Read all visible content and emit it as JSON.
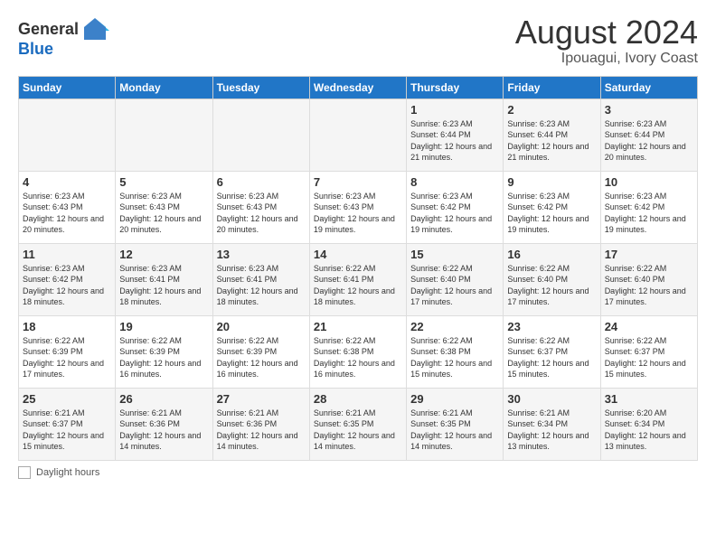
{
  "header": {
    "logo_line1": "General",
    "logo_line2": "Blue",
    "month_title": "August 2024",
    "location": "Ipouagui, Ivory Coast"
  },
  "days_of_week": [
    "Sunday",
    "Monday",
    "Tuesday",
    "Wednesday",
    "Thursday",
    "Friday",
    "Saturday"
  ],
  "weeks": [
    [
      {
        "day": "",
        "info": ""
      },
      {
        "day": "",
        "info": ""
      },
      {
        "day": "",
        "info": ""
      },
      {
        "day": "",
        "info": ""
      },
      {
        "day": "1",
        "info": "Sunrise: 6:23 AM\nSunset: 6:44 PM\nDaylight: 12 hours and 21 minutes."
      },
      {
        "day": "2",
        "info": "Sunrise: 6:23 AM\nSunset: 6:44 PM\nDaylight: 12 hours and 21 minutes."
      },
      {
        "day": "3",
        "info": "Sunrise: 6:23 AM\nSunset: 6:44 PM\nDaylight: 12 hours and 20 minutes."
      }
    ],
    [
      {
        "day": "4",
        "info": "Sunrise: 6:23 AM\nSunset: 6:43 PM\nDaylight: 12 hours and 20 minutes."
      },
      {
        "day": "5",
        "info": "Sunrise: 6:23 AM\nSunset: 6:43 PM\nDaylight: 12 hours and 20 minutes."
      },
      {
        "day": "6",
        "info": "Sunrise: 6:23 AM\nSunset: 6:43 PM\nDaylight: 12 hours and 20 minutes."
      },
      {
        "day": "7",
        "info": "Sunrise: 6:23 AM\nSunset: 6:43 PM\nDaylight: 12 hours and 19 minutes."
      },
      {
        "day": "8",
        "info": "Sunrise: 6:23 AM\nSunset: 6:42 PM\nDaylight: 12 hours and 19 minutes."
      },
      {
        "day": "9",
        "info": "Sunrise: 6:23 AM\nSunset: 6:42 PM\nDaylight: 12 hours and 19 minutes."
      },
      {
        "day": "10",
        "info": "Sunrise: 6:23 AM\nSunset: 6:42 PM\nDaylight: 12 hours and 19 minutes."
      }
    ],
    [
      {
        "day": "11",
        "info": "Sunrise: 6:23 AM\nSunset: 6:42 PM\nDaylight: 12 hours and 18 minutes."
      },
      {
        "day": "12",
        "info": "Sunrise: 6:23 AM\nSunset: 6:41 PM\nDaylight: 12 hours and 18 minutes."
      },
      {
        "day": "13",
        "info": "Sunrise: 6:23 AM\nSunset: 6:41 PM\nDaylight: 12 hours and 18 minutes."
      },
      {
        "day": "14",
        "info": "Sunrise: 6:22 AM\nSunset: 6:41 PM\nDaylight: 12 hours and 18 minutes."
      },
      {
        "day": "15",
        "info": "Sunrise: 6:22 AM\nSunset: 6:40 PM\nDaylight: 12 hours and 17 minutes."
      },
      {
        "day": "16",
        "info": "Sunrise: 6:22 AM\nSunset: 6:40 PM\nDaylight: 12 hours and 17 minutes."
      },
      {
        "day": "17",
        "info": "Sunrise: 6:22 AM\nSunset: 6:40 PM\nDaylight: 12 hours and 17 minutes."
      }
    ],
    [
      {
        "day": "18",
        "info": "Sunrise: 6:22 AM\nSunset: 6:39 PM\nDaylight: 12 hours and 17 minutes."
      },
      {
        "day": "19",
        "info": "Sunrise: 6:22 AM\nSunset: 6:39 PM\nDaylight: 12 hours and 16 minutes."
      },
      {
        "day": "20",
        "info": "Sunrise: 6:22 AM\nSunset: 6:39 PM\nDaylight: 12 hours and 16 minutes."
      },
      {
        "day": "21",
        "info": "Sunrise: 6:22 AM\nSunset: 6:38 PM\nDaylight: 12 hours and 16 minutes."
      },
      {
        "day": "22",
        "info": "Sunrise: 6:22 AM\nSunset: 6:38 PM\nDaylight: 12 hours and 15 minutes."
      },
      {
        "day": "23",
        "info": "Sunrise: 6:22 AM\nSunset: 6:37 PM\nDaylight: 12 hours and 15 minutes."
      },
      {
        "day": "24",
        "info": "Sunrise: 6:22 AM\nSunset: 6:37 PM\nDaylight: 12 hours and 15 minutes."
      }
    ],
    [
      {
        "day": "25",
        "info": "Sunrise: 6:21 AM\nSunset: 6:37 PM\nDaylight: 12 hours and 15 minutes."
      },
      {
        "day": "26",
        "info": "Sunrise: 6:21 AM\nSunset: 6:36 PM\nDaylight: 12 hours and 14 minutes."
      },
      {
        "day": "27",
        "info": "Sunrise: 6:21 AM\nSunset: 6:36 PM\nDaylight: 12 hours and 14 minutes."
      },
      {
        "day": "28",
        "info": "Sunrise: 6:21 AM\nSunset: 6:35 PM\nDaylight: 12 hours and 14 minutes."
      },
      {
        "day": "29",
        "info": "Sunrise: 6:21 AM\nSunset: 6:35 PM\nDaylight: 12 hours and 14 minutes."
      },
      {
        "day": "30",
        "info": "Sunrise: 6:21 AM\nSunset: 6:34 PM\nDaylight: 12 hours and 13 minutes."
      },
      {
        "day": "31",
        "info": "Sunrise: 6:20 AM\nSunset: 6:34 PM\nDaylight: 12 hours and 13 minutes."
      }
    ]
  ],
  "footer": {
    "label": "Daylight hours"
  }
}
